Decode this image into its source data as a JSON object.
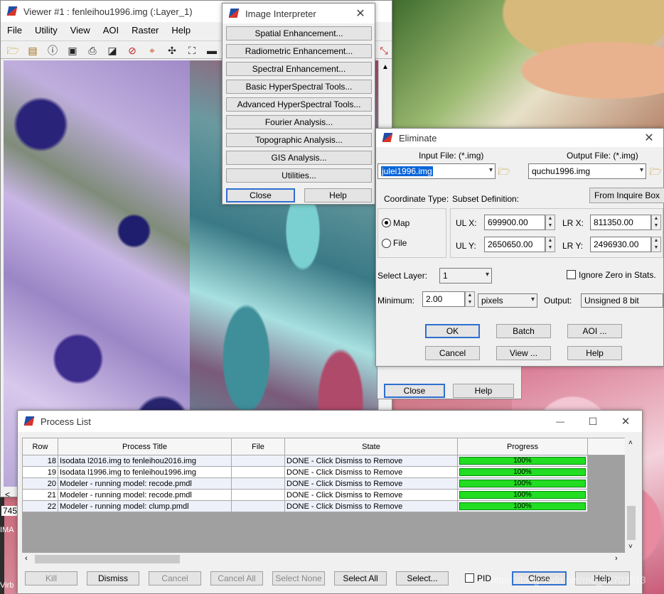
{
  "viewer": {
    "title": "Viewer #1 : fenleihou1996.img (:Layer_1)",
    "menu": [
      "File",
      "Utility",
      "View",
      "AOI",
      "Raster",
      "Help"
    ],
    "left_status": "745",
    "left_status2": "IMA",
    "left_bottom": "Virb",
    "scroll_left_arrow": "<"
  },
  "interpreter": {
    "title": "Image Interpreter",
    "buttons": [
      "Spatial Enhancement...",
      "Radiometric Enhancement...",
      "Spectral Enhancement...",
      "Basic HyperSpectral Tools...",
      "Advanced HyperSpectral Tools...",
      "Fourier Analysis...",
      "Topographic Analysis...",
      "GIS Analysis...",
      "Utilities..."
    ],
    "close": "Close",
    "help": "Help"
  },
  "eliminate": {
    "title": "Eliminate",
    "input_label": "Input File: (*.img)",
    "input_value": "julei1996.img",
    "output_label": "Output File: (*.img)",
    "output_value": "quchu1996.img",
    "coord_label": "Coordinate Type:",
    "subset_label": "Subset Definition:",
    "inquire_btn": "From Inquire Box",
    "map_label": "Map",
    "file_label": "File",
    "ulx_label": "UL X:",
    "ulx_value": "699900.00",
    "uly_label": "UL Y:",
    "uly_value": "2650650.00",
    "lrx_label": "LR X:",
    "lrx_value": "811350.00",
    "lry_label": "LR Y:",
    "lry_value": "2496930.00",
    "select_layer_label": "Select Layer:",
    "select_layer_value": "1",
    "ignore_zero_label": "Ignore Zero in Stats.",
    "minimum_label": "Minimum:",
    "minimum_value": "2.00",
    "unit_value": "pixels",
    "output_label2": "Output:",
    "output_type": "Unsigned 8 bit",
    "ok": "OK",
    "batch": "Batch",
    "aoi": "AOI ...",
    "cancel": "Cancel",
    "view": "View ...",
    "help": "Help"
  },
  "behind_dialog": {
    "close": "Close",
    "help": "Help"
  },
  "process": {
    "title": "Process List",
    "headers": [
      "Row",
      "Process Title",
      "File",
      "State",
      "Progress"
    ],
    "rows": [
      {
        "row": "18",
        "title": "Isodata l2016.img to fenleihou2016.img",
        "file": "",
        "state": "DONE - Click Dismiss to Remove",
        "progress": "100%"
      },
      {
        "row": "19",
        "title": "Isodata l1996.img to fenleihou1996.img",
        "file": "",
        "state": "DONE - Click Dismiss to Remove",
        "progress": "100%"
      },
      {
        "row": "20",
        "title": "Modeler - running model: recode.pmdl",
        "file": "",
        "state": "DONE - Click Dismiss to Remove",
        "progress": "100%"
      },
      {
        "row": "21",
        "title": "Modeler - running model: recode.pmdl",
        "file": "",
        "state": "DONE - Click Dismiss to Remove",
        "progress": "100%"
      },
      {
        "row": "22",
        "title": "Modeler - running model: clump.pmdl",
        "file": "",
        "state": "DONE - Click Dismiss to Remove",
        "progress": "100%"
      }
    ],
    "buttons": {
      "kill": "Kill",
      "dismiss": "Dismiss",
      "cancel": "Cancel",
      "cancel_all": "Cancel All",
      "select_none": "Select None",
      "select_all": "Select All",
      "select": "Select...",
      "pid": "PID",
      "close": "Close",
      "help": "Help"
    },
    "min_glyph": "—",
    "max_glyph": "☐",
    "close_glyph": "✕"
  },
  "watermark": "https://blog.csdn.net/m0_52703513",
  "colors": {
    "progress": "#22dd22",
    "selection": "#0a64d8",
    "accent": "#2f6fd0"
  }
}
